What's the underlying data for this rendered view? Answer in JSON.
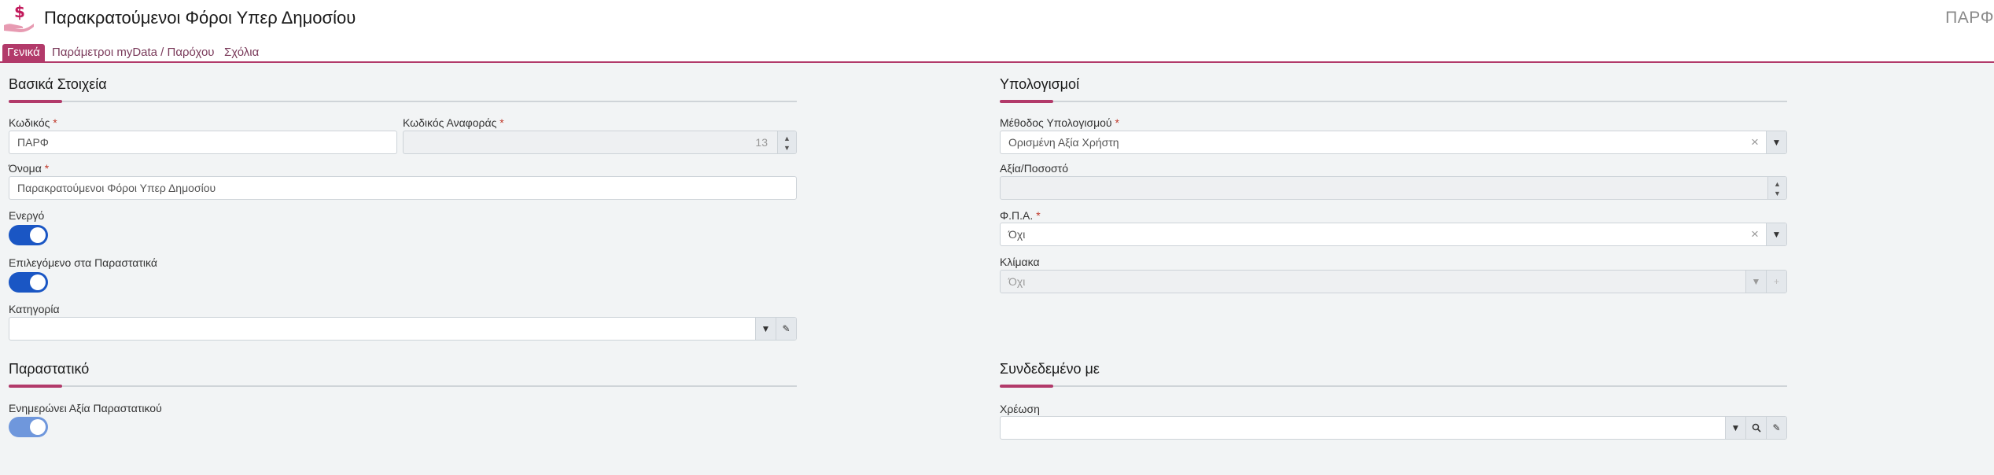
{
  "header": {
    "logo": "dollar-hand-icon",
    "title": "Παρακρατούμενοι Φόροι Υπερ Δημοσίου",
    "right_code": "ΠΑΡΦ"
  },
  "tabs": [
    {
      "label": "Γενικά",
      "active": true
    },
    {
      "label": "Παράμετροι myData / Παρόχου",
      "active": false
    },
    {
      "label": "Σχόλια",
      "active": false
    }
  ],
  "colors": {
    "accent": "#b23a6a",
    "toggle_on": "#1a56c4",
    "background": "#f2f4f5"
  },
  "basic": {
    "title": "Βασικά Στοιχεία",
    "code": {
      "label": "Κωδικός",
      "value": "ΠΑΡΦ"
    },
    "ref_code": {
      "label": "Κωδικός Αναφοράς",
      "value": "13"
    },
    "name": {
      "label": "Όνομα",
      "value": "Παρακρατούμενοι Φόροι Υπερ Δημοσίου"
    },
    "active": {
      "label": "Ενεργό",
      "on": true
    },
    "preselected": {
      "label": "Επιλεγόμενο στα Παραστατικά",
      "on": true
    },
    "category": {
      "label": "Κατηγορία",
      "value": ""
    }
  },
  "document": {
    "title": "Παραστατικό",
    "updates_value": {
      "label": "Ενημερώνει Αξία Παραστατικού",
      "on": true
    }
  },
  "calc": {
    "title": "Υπολογισμοί",
    "method": {
      "label": "Μέθοδος Υπολογισμού",
      "value": "Ορισμένη Αξία Χρήστη"
    },
    "value_percent": {
      "label": "Αξία/Ποσοστό",
      "value": ""
    },
    "vat": {
      "label": "Φ.Π.Α.",
      "value": "Όχι"
    },
    "scale": {
      "label": "Κλίμακα",
      "value": "Όχι"
    }
  },
  "linked": {
    "title": "Συνδεδεμένο με",
    "debit": {
      "label": "Χρέωση",
      "value": ""
    }
  },
  "required_mark": "*"
}
